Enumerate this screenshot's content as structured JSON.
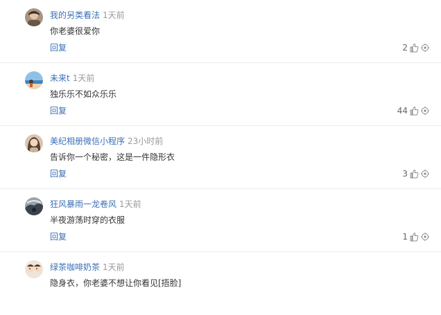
{
  "comments": [
    {
      "username": "我的另类看法",
      "time": "1天前",
      "content": "你老婆很爱你",
      "reply_label": "回复",
      "likes": "2",
      "avatar_icon": "avatar-man-icon",
      "avatar_color": "#7a6a5a"
    },
    {
      "username": "未来t",
      "time": "1天前",
      "content": "独乐乐不如众乐乐",
      "reply_label": "回复",
      "likes": "44",
      "avatar_icon": "avatar-beach-icon",
      "avatar_color": "#6fa2c9"
    },
    {
      "username": "美纪相册微信小程序",
      "time": "23小时前",
      "content": "告诉你一个秘密，这是一件隐形衣",
      "reply_label": "回复",
      "likes": "3",
      "avatar_icon": "avatar-woman-icon",
      "avatar_color": "#b8a28a"
    },
    {
      "username": "狂风暴雨一龙卷风",
      "time": "1天前",
      "content": "半夜游荡时穿的衣服",
      "reply_label": "回复",
      "likes": "1",
      "avatar_icon": "avatar-storm-icon",
      "avatar_color": "#5a6470"
    },
    {
      "username": "绿茶咖啡奶茶",
      "time": "1天前",
      "content": "隐身衣，你老婆不想让你看见[捂脸]",
      "reply_label": "回复",
      "likes": "",
      "avatar_icon": "avatar-cartoon-icon",
      "avatar_color": "#d9c7b5"
    }
  ],
  "colors": {
    "username": "#3b6fb6",
    "reply": "#3b6fb6",
    "time": "#999999",
    "content": "#333333",
    "icon": "#8a8a8a"
  }
}
